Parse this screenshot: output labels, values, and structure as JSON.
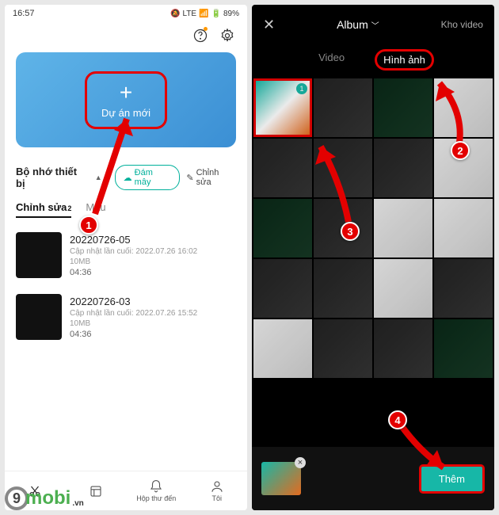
{
  "left": {
    "status": {
      "time": "16:57",
      "battery": "89%"
    },
    "new_project": {
      "label": "Dự án mới"
    },
    "storage": {
      "title": "Bộ nhớ thiết bị",
      "cloud_label": "Đám mây",
      "edit_label": "Chỉnh sửa"
    },
    "tabs": {
      "edit": "Chỉnh sửa",
      "edit_count": "2",
      "template": "Mẫu"
    },
    "projects": [
      {
        "name": "20220726-05",
        "updated": "Cập nhật lần cuối: 2022.07.26 16:02",
        "size": "10MB",
        "duration": "04:36"
      },
      {
        "name": "20220726-03",
        "updated": "Cập nhật lần cuối: 2022.07.26 15:52",
        "size": "10MB",
        "duration": "04:36"
      }
    ],
    "nav": {
      "inbox": "Hộp thư đến",
      "me": "Tôi"
    }
  },
  "right": {
    "header": {
      "album": "Album",
      "library": "Kho video"
    },
    "tabs": {
      "video": "Video",
      "image": "Hình ảnh"
    },
    "add_button": "Thêm"
  },
  "steps": {
    "s1": "1",
    "s2": "2",
    "s3": "3",
    "s4": "4"
  },
  "watermark": {
    "brand": "mobi",
    "suffix": ".vn",
    "nine": "9"
  }
}
